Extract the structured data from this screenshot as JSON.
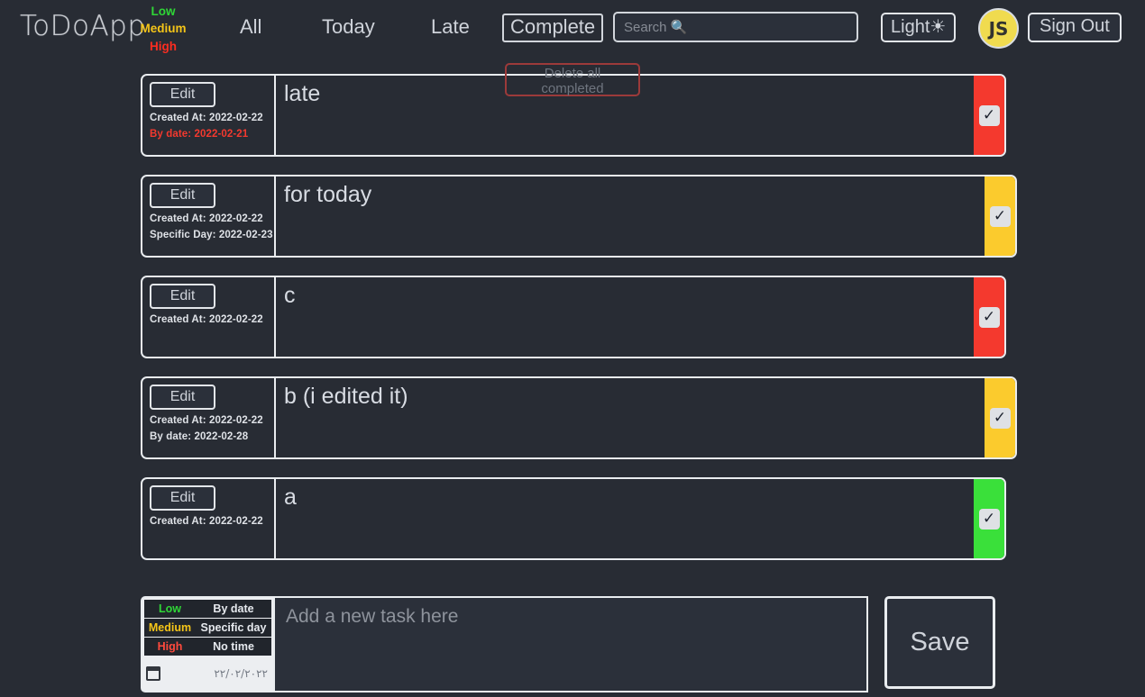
{
  "header": {
    "brand": "ToDoApp",
    "legend": [
      {
        "label": "Low",
        "color": "#2fd636"
      },
      {
        "label": "Medium",
        "color": "#f5c518"
      },
      {
        "label": "High",
        "color": "#ff2d20"
      }
    ],
    "nav": [
      {
        "name": "all",
        "label": "All",
        "active": false
      },
      {
        "name": "today",
        "label": "Today",
        "active": false
      },
      {
        "name": "late",
        "label": "Late",
        "active": false
      },
      {
        "name": "complete",
        "label": "Complete",
        "active": true
      }
    ],
    "search": {
      "value": "",
      "placeholder": "Search 🔍"
    },
    "theme_button": "Light☀",
    "avatar_initials": "JS",
    "signout_button": "Sign Out"
  },
  "actions": {
    "delete_all_completed": "Delete all completed"
  },
  "todos": [
    {
      "text": "late",
      "edit_label": "Edit",
      "created_label": "Created At: 2022-02-22",
      "date_label": "By date: 2022-02-21",
      "overdue": true,
      "priority": "High",
      "priority_color": "#f4392e",
      "completed": true,
      "check_glyph": "✓"
    },
    {
      "text": "for today",
      "edit_label": "Edit",
      "created_label": "Created At: 2022-02-22",
      "date_label": "Specific Day: 2022-02-23",
      "overdue": false,
      "priority": "Medium",
      "priority_color": "#fbcb2d",
      "completed": true,
      "check_glyph": "✓"
    },
    {
      "text": "c",
      "edit_label": "Edit",
      "created_label": "Created At: 2022-02-22",
      "date_label": "",
      "overdue": false,
      "priority": "High",
      "priority_color": "#f4392e",
      "completed": true,
      "check_glyph": "✓"
    },
    {
      "text": "b (i edited it)",
      "edit_label": "Edit",
      "created_label": "Created At: 2022-02-22",
      "date_label": "By date: 2022-02-28",
      "overdue": false,
      "priority": "Medium",
      "priority_color": "#fbcb2d",
      "completed": true,
      "check_glyph": "✓"
    },
    {
      "text": "a",
      "edit_label": "Edit",
      "created_label": "Created At: 2022-02-22",
      "date_label": "",
      "overdue": false,
      "priority": "Low",
      "priority_color": "#3ae03a",
      "completed": true,
      "check_glyph": "✓"
    }
  ],
  "add_form": {
    "priority_options": [
      {
        "label": "Low",
        "color": "#2fd636"
      },
      {
        "label": "Medium",
        "color": "#f5c518"
      },
      {
        "label": "High",
        "color": "#ff4a3d"
      }
    ],
    "time_options": [
      {
        "label": "By date"
      },
      {
        "label": "Specific day"
      },
      {
        "label": "No time"
      }
    ],
    "date_value": "٢٢/٠٢/٢٠٢٢",
    "task_value": "",
    "task_placeholder": "Add a new task here",
    "save_label": "Save"
  }
}
